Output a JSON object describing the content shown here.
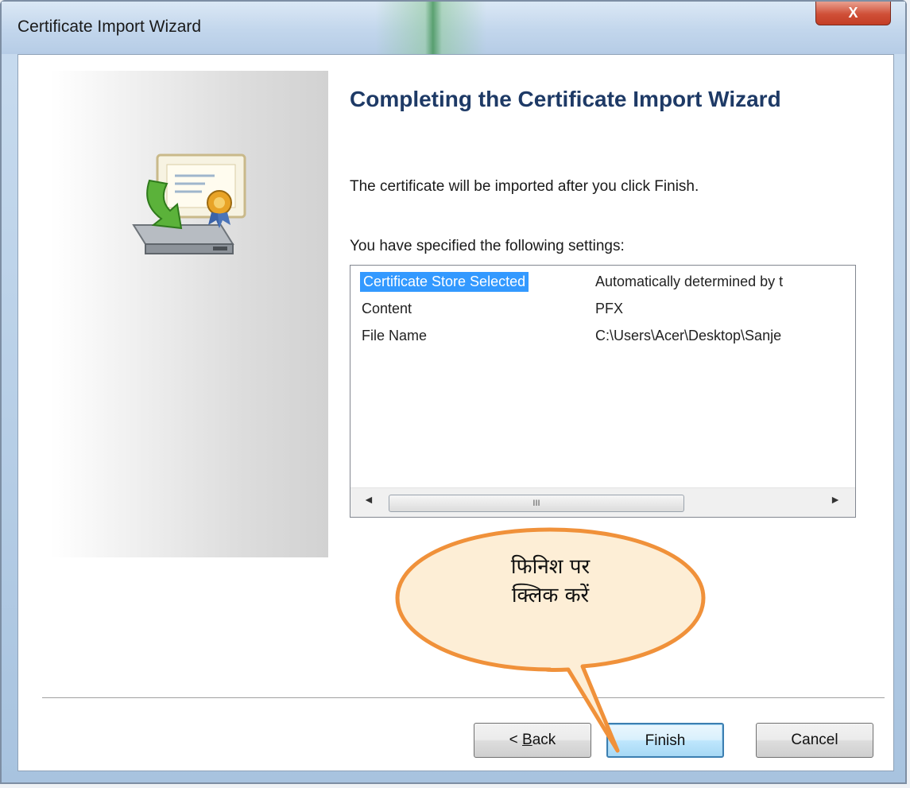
{
  "window": {
    "title": "Certificate Import Wizard",
    "close_label": "X"
  },
  "main": {
    "heading": "Completing the Certificate Import Wizard",
    "description": "The certificate will be imported after you click Finish.",
    "settings_label": "You have specified the following settings:",
    "settings": [
      {
        "key": "Certificate Store Selected",
        "value": "Automatically determined by t",
        "selected": true
      },
      {
        "key": "Content",
        "value": "PFX",
        "selected": false
      },
      {
        "key": "File Name",
        "value": "C:\\Users\\Acer\\Desktop\\Sanje",
        "selected": false
      }
    ],
    "scrollbar_grip": "III"
  },
  "buttons": {
    "back_prefix": "< ",
    "back_mnemonic": "B",
    "back_rest": "ack",
    "finish": "Finish",
    "cancel": "Cancel"
  },
  "callout": {
    "line1": "फिनिश पर",
    "line2": "क्लिक करें"
  },
  "colors": {
    "selection": "#3399ff",
    "heading": "#1e3a66",
    "callout_fill": "#fdeed6",
    "callout_border": "#f0913a",
    "close_button": "#cf4f37"
  },
  "icons": [
    "certificate-import-icon",
    "left-arrow-icon",
    "right-arrow-icon"
  ]
}
